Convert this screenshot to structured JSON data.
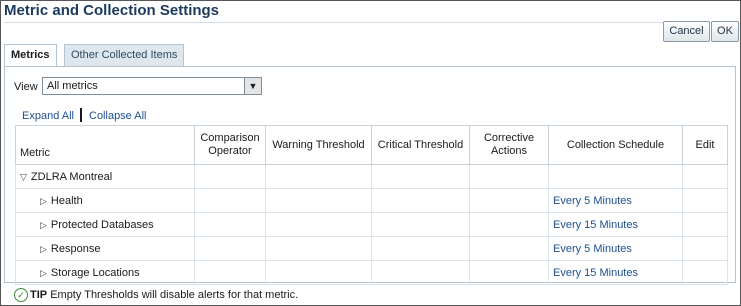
{
  "page": {
    "title": "Metric and Collection Settings"
  },
  "buttons": {
    "cancel": "Cancel",
    "ok": "OK"
  },
  "tabs": [
    {
      "label": "Metrics",
      "active": true
    },
    {
      "label": "Other Collected Items",
      "active": false
    }
  ],
  "view": {
    "label": "View",
    "selected": "All metrics"
  },
  "links": {
    "expand_all": "Expand All",
    "collapse_all": "Collapse All"
  },
  "table": {
    "headers": {
      "metric": "Metric",
      "comparison_operator": "Comparison Operator",
      "warning_threshold": "Warning Threshold",
      "critical_threshold": "Critical Threshold",
      "corrective_actions": "Corrective Actions",
      "collection_schedule": "Collection Schedule",
      "edit": "Edit"
    },
    "rows": [
      {
        "metric": "ZDLRA Montreal",
        "level": 0,
        "expanded": true,
        "schedule": ""
      },
      {
        "metric": "Health",
        "level": 1,
        "expanded": false,
        "schedule": "Every 5 Minutes"
      },
      {
        "metric": "Protected Databases",
        "level": 1,
        "expanded": false,
        "schedule": "Every 15 Minutes"
      },
      {
        "metric": "Response",
        "level": 1,
        "expanded": false,
        "schedule": "Every 5 Minutes"
      },
      {
        "metric": "Storage Locations",
        "level": 1,
        "expanded": false,
        "schedule": "Every 15 Minutes"
      }
    ]
  },
  "tip": {
    "label": "TIP",
    "text": "Empty Thresholds will disable alerts for that metric."
  }
}
